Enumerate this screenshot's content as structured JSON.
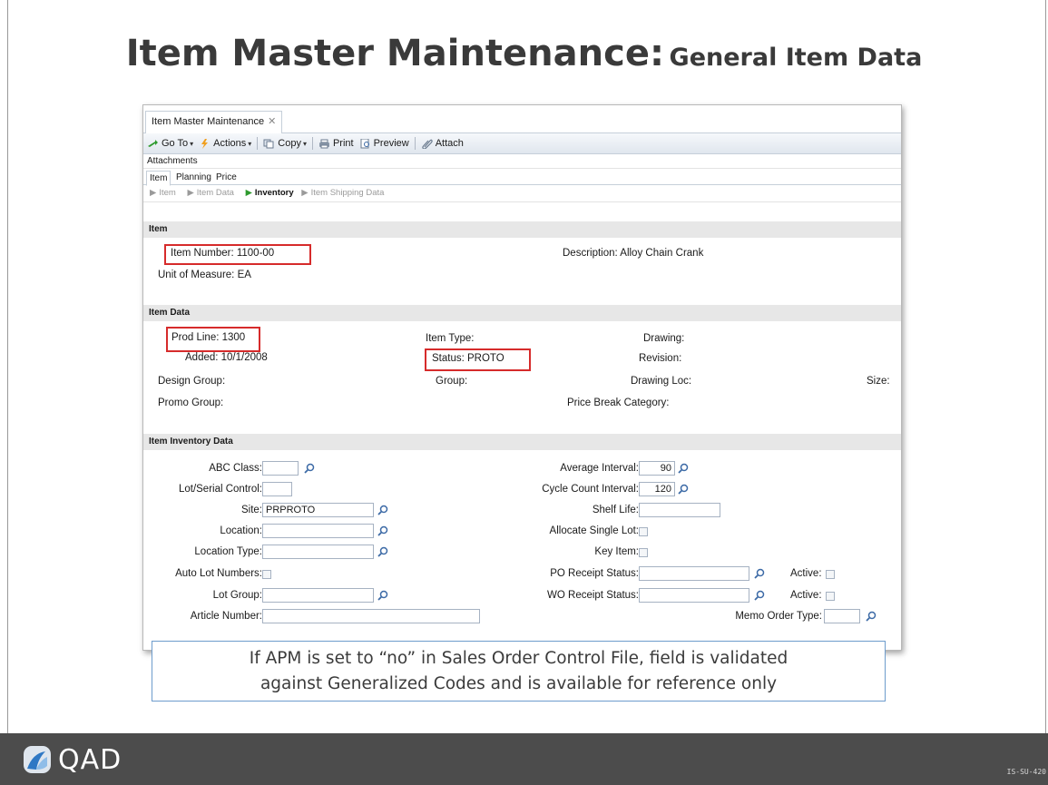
{
  "slide": {
    "title_main": "Item Master Maintenance:",
    "title_sub": "General Item Data",
    "note_line1": "If APM is set to “no” in Sales Order Control File, field is validated",
    "note_line2": "against Generalized Codes and is available for reference only",
    "logo_text": "QAD",
    "footer_code": "IS-SU-420"
  },
  "window": {
    "tab_label": "Item Master Maintenance",
    "tab_close": "✕"
  },
  "toolbar": {
    "goto_label": "Go To",
    "actions_label": "Actions",
    "copy_label": "Copy",
    "print_label": "Print",
    "preview_label": "Preview",
    "attach_label": "Attach",
    "caret": "▾"
  },
  "attachments_label": "Attachments",
  "subtabs": [
    "Item",
    "Planning",
    "Price"
  ],
  "breadcrumb": {
    "arrow": "▶",
    "items": [
      "Item",
      "Item Data",
      "Inventory",
      "Item Shipping Data"
    ]
  },
  "item_section": {
    "header": "Item",
    "item_number": "Item Number: 1100-00",
    "description": "Description: Alloy Chain Crank",
    "uom": "Unit of Measure: EA"
  },
  "item_data_section": {
    "header": "Item Data",
    "prod_line": "Prod Line: 1300",
    "added": "Added: 10/1/2008",
    "design_group": "Design Group:",
    "promo_group": "Promo Group:",
    "item_type": "Item Type:",
    "status": "Status: PROTO",
    "group": "Group:",
    "drawing": "Drawing:",
    "revision": "Revision:",
    "drawing_loc": "Drawing Loc:",
    "price_break": "Price Break Category:",
    "size": "Size:"
  },
  "inventory_section": {
    "header": "Item Inventory Data",
    "abc_class": "ABC Class:",
    "lot_serial": "Lot/Serial Control:",
    "site": "Site:",
    "site_value": "PRPROTO",
    "location": "Location:",
    "location_type": "Location Type:",
    "auto_lot": "Auto Lot Numbers:",
    "lot_group": "Lot Group:",
    "article_number": "Article Number:",
    "avg_interval": "Average Interval:",
    "avg_interval_value": "90",
    "cycle_count": "Cycle Count Interval:",
    "cycle_count_value": "120",
    "shelf_life": "Shelf Life:",
    "allocate_single": "Allocate Single Lot:",
    "key_item": "Key Item:",
    "po_receipt": "PO Receipt Status:",
    "wo_receipt": "WO Receipt Status:",
    "active": "Active:",
    "memo_order_type": "Memo Order Type:"
  },
  "colors": {
    "highlight_box": "#d62b2b",
    "section_bg": "#e7e7e7",
    "footer_bg": "#4c4c4c",
    "note_border": "#6d9ccc",
    "breadcrumb_active_arrow": "#2e9a2e"
  }
}
